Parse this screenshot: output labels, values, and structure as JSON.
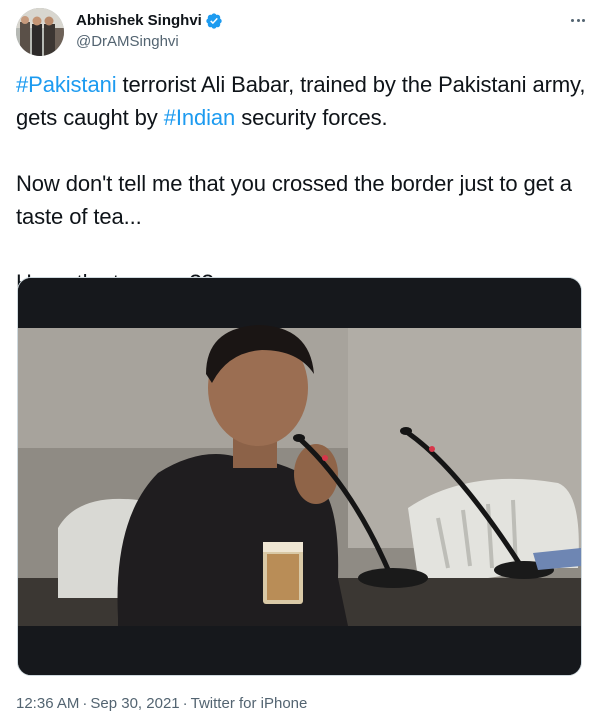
{
  "author": {
    "display_name": "Abhishek Singhvi",
    "handle": "@DrAMSinghvi",
    "verified": true
  },
  "tweet": {
    "line1": {
      "hashtag1": "#Pakistani",
      "text1": " terrorist Ali Babar, trained by the Pakistani army, gets caught by ",
      "hashtag2": "#Indian",
      "text2": " security forces."
    },
    "line2": "Now don't tell me that you crossed the border just to get a taste of tea...",
    "line3": "Hows the tea now??"
  },
  "media": {
    "type": "video"
  },
  "meta": {
    "time": "12:36 AM",
    "separator": "·",
    "date": "Sep 30, 2021",
    "source": "Twitter for iPhone"
  },
  "colors": {
    "link": "#1d9bf0",
    "secondary_text": "#536471",
    "primary_text": "#0f1419"
  },
  "icons": {
    "verified": "verified-badge-icon",
    "more": "more-options-icon"
  }
}
